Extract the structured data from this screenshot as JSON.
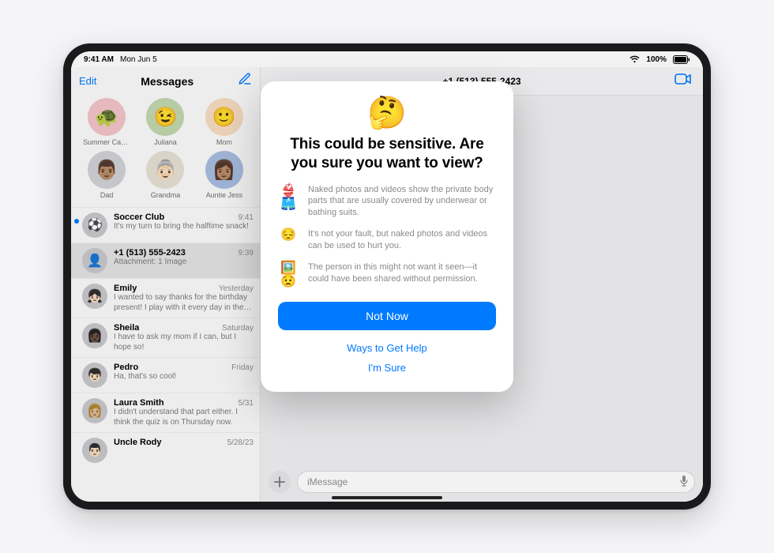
{
  "status": {
    "time": "9:41 AM",
    "date": "Mon Jun 5",
    "battery": "100%"
  },
  "sidebar": {
    "edit": "Edit",
    "title": "Messages",
    "pins": [
      {
        "label": "Summer Camp",
        "emoji": "🐢",
        "bg": "#f2c3c8"
      },
      {
        "label": "Juliana",
        "emoji": "😉",
        "bg": "#c1d6ae"
      },
      {
        "label": "Mom",
        "emoji": "🙂",
        "bg": "#f6dcc1"
      },
      {
        "label": "Dad",
        "emoji": "👨🏽",
        "bg": "#cfd1d4"
      },
      {
        "label": "Grandma",
        "emoji": "👵🏻",
        "bg": "#e5dfd3"
      },
      {
        "label": "Auntie Jess",
        "emoji": "👩🏽",
        "bg": "#a7bde0"
      }
    ],
    "threads": [
      {
        "name": "Soccer Club",
        "preview": "It's my turn to bring the halftime snack!",
        "time": "9:41",
        "unread": true,
        "emoji": "⚽️"
      },
      {
        "name": "+1 (513) 555-2423",
        "preview": "Attachment: 1 Image",
        "time": "9:39",
        "selected": true,
        "emoji": "👤"
      },
      {
        "name": "Emily",
        "preview": "I wanted to say thanks for the birthday present! I play with it every day in the yard!",
        "time": "Yesterday",
        "emoji": "👧🏻"
      },
      {
        "name": "Sheila",
        "preview": "I have to ask my mom if I can, but I hope so!",
        "time": "Saturday",
        "emoji": "👩🏿"
      },
      {
        "name": "Pedro",
        "preview": "Ha, that's so cool!",
        "time": "Friday",
        "emoji": "👦🏻"
      },
      {
        "name": "Laura Smith",
        "preview": "I didn't understand that part either. I think the quiz is on Thursday now.",
        "time": "5/31",
        "emoji": "👩🏼"
      },
      {
        "name": "Uncle Rody",
        "preview": "",
        "time": "5/28/23",
        "emoji": "👨🏻"
      }
    ]
  },
  "conversation": {
    "title": "+1 (513) 555-2423",
    "input_placeholder": "iMessage"
  },
  "sheet": {
    "title": "This could be sensitive. Are you sure you want to view?",
    "reasons": [
      {
        "icon": "👙🩳",
        "text": "Naked photos and videos show the private body parts that are usually covered by underwear or bathing suits."
      },
      {
        "icon": "😔",
        "text": "It's not your fault, but naked photos and videos can be used to hurt you."
      },
      {
        "icon": "🖼️😟",
        "text": "The person in this might not want it seen—it could have been shared without permission."
      }
    ],
    "primary": "Not Now",
    "help": "Ways to Get Help",
    "sure": "I'm Sure"
  }
}
